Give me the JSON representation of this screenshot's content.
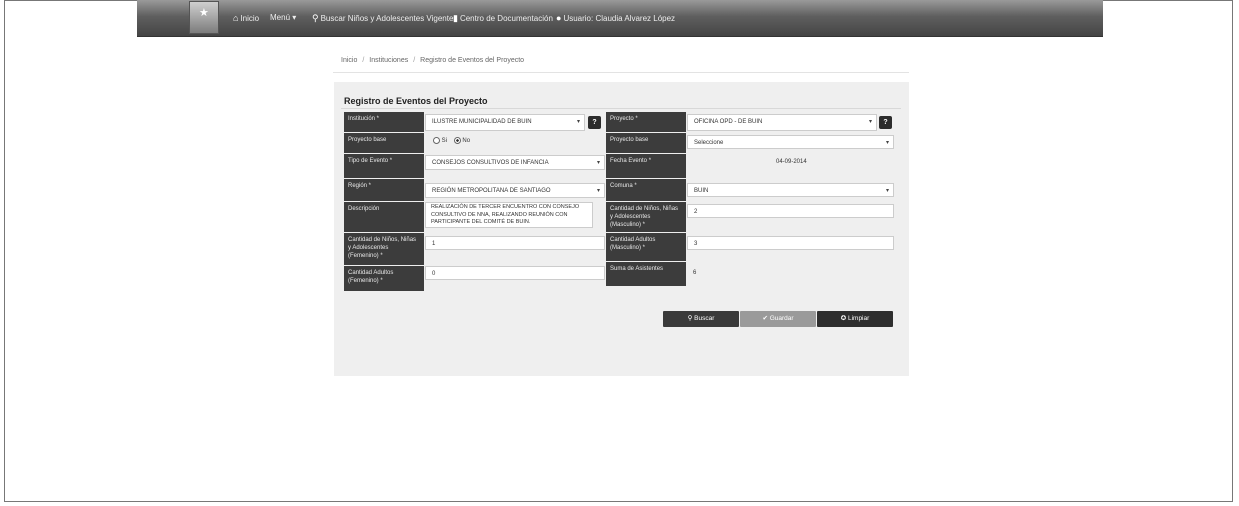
{
  "nav": {
    "items": [
      {
        "icon": "home-icon",
        "glyph": "⌂",
        "label": "Inicio"
      },
      {
        "icon": "",
        "glyph": "",
        "label": "Menú ▾"
      },
      {
        "icon": "search-icon",
        "glyph": "⚲",
        "label": "Buscar Niños y Adolescentes Vigentes"
      },
      {
        "icon": "document-icon",
        "glyph": "▮",
        "label": "Centro de Documentación"
      },
      {
        "icon": "user-icon",
        "glyph": "●",
        "label": "Usuario: Claudia Alvarez López"
      }
    ]
  },
  "breadcrumb": [
    "Inicio",
    "Instituciones",
    "Registro de Eventos del Proyecto"
  ],
  "page_title": "Registro de Eventos del Proyecto",
  "form": {
    "institucion": {
      "label": "Institución *",
      "value": "ILUSTRE MUNICIPALIDAD DE BUIN"
    },
    "proyecto": {
      "label": "Proyecto *",
      "value": "OFICINA OPD - DE BUIN"
    },
    "proyecto_base": {
      "label": "Proyecto base",
      "options": [
        "Si",
        "No"
      ],
      "selected": "No"
    },
    "proyecto_base_select": {
      "label": "Proyecto base",
      "value": "Seleccione"
    },
    "tipo_evento": {
      "label": "Tipo de Evento *",
      "value": "CONSEJOS CONSULTIVOS DE INFANCIA"
    },
    "fecha_evento": {
      "label": "Fecha Evento *",
      "value": "04-09-2014"
    },
    "region": {
      "label": "Región *",
      "value": "REGIÓN METROPOLITANA DE SANTIAGO"
    },
    "comuna": {
      "label": "Comuna *",
      "value": "BUIN"
    },
    "descripcion": {
      "label": "Descripción",
      "value": "REALIZACIÓN DE TERCER ENCUENTRO CON CONSEJO CONSULTIVO DE NNA, REALIZANDO REUNIÓN CON PARTICIPANTE DEL COMITÉ DE BUIN."
    },
    "cantidad_ninos_masc": {
      "label": "Cantidad de Niños, Niñas y Adolescentes (Masculino) *",
      "value": "2"
    },
    "cantidad_ninos_fem": {
      "label": "Cantidad de Niños, Niñas y Adolescentes (Femenino) *",
      "value": "1"
    },
    "cantidad_adultos_masc": {
      "label": "Cantidad Adultos (Masculino) *",
      "value": "3"
    },
    "cantidad_adultos_fem": {
      "label": "Cantidad Adultos (Femenino) *",
      "value": "0"
    },
    "suma_asistentes": {
      "label": "Suma de Asistentes",
      "value": "6"
    }
  },
  "buttons": {
    "buscar": "Buscar",
    "guardar": "Guardar",
    "limpiar": "Limpiar"
  },
  "colors": {
    "label_bg": "#3c3c3c",
    "navbar": "#555555",
    "button_dark": "#3a3a3a",
    "button_disabled": "#9a9a9a"
  }
}
